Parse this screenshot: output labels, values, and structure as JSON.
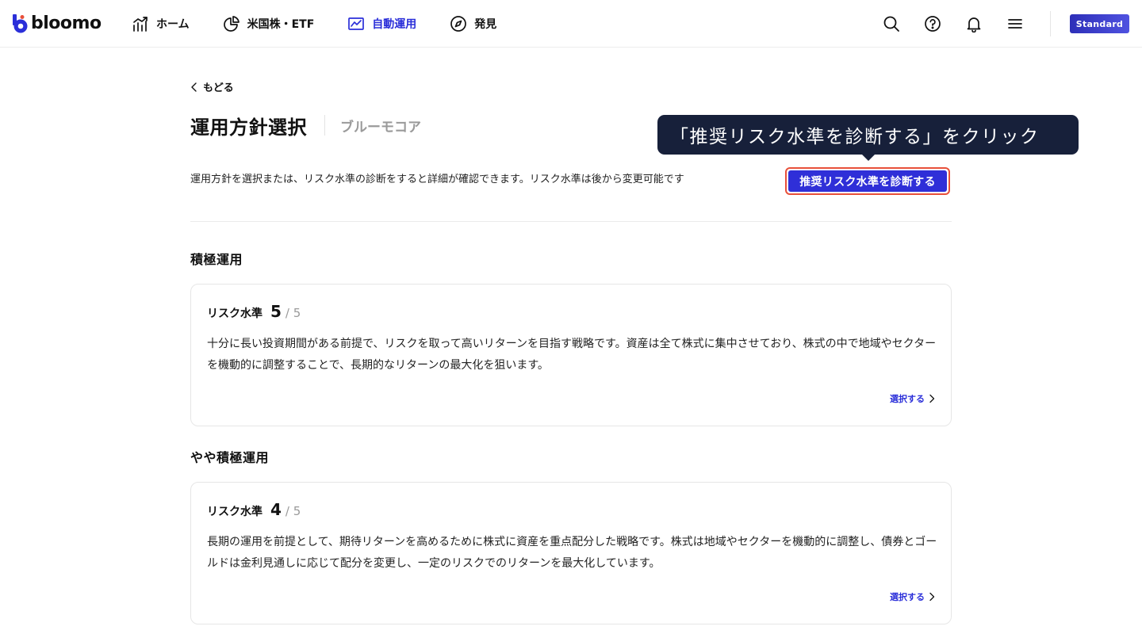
{
  "header": {
    "logo_text": "bloomo",
    "nav": [
      {
        "label": "ホーム",
        "icon": "chart-up-icon",
        "active": false
      },
      {
        "label": "米国株・ETF",
        "icon": "pie-chart-icon",
        "active": false
      },
      {
        "label": "自動運用",
        "icon": "line-chart-icon",
        "active": true
      },
      {
        "label": "発見",
        "icon": "compass-icon",
        "active": false
      }
    ],
    "icons": [
      "search-icon",
      "help-icon",
      "bell-icon",
      "menu-icon"
    ],
    "plan_badge": "Standard"
  },
  "main": {
    "back_label": "もどる",
    "title": "運用方針選択",
    "subtitle": "ブルーモコア",
    "description": "運用方針を選択または、リスク水準の診断をすると詳細が確認できます。リスク水準は後から変更可能です",
    "diagnose_button": "推奨リスク水準を診断する",
    "tooltip": "「推奨リスク水準を診断する」をクリック",
    "sections": [
      {
        "heading": "積極運用",
        "risk_label": "リスク水準",
        "risk_value": "5",
        "risk_max": "/ 5",
        "description": "十分に長い投資期間がある前提で、リスクを取って高いリターンを目指す戦略です。資産は全て株式に集中させており、株式の中で地域やセクターを機動的に調整することで、長期的なリターンの最大化を狙います。",
        "select_label": "選択する"
      },
      {
        "heading": "やや積極運用",
        "risk_label": "リスク水準",
        "risk_value": "4",
        "risk_max": "/ 5",
        "description": "長期の運用を前提として、期待リターンを高めるために株式に資産を重点配分した戦略です。株式は地域やセクターを機動的に調整し、債券とゴールドは金利見通しに応じて配分を変更し、一定のリスクでのリターンを最大化しています。",
        "select_label": "選択する"
      }
    ]
  },
  "colors": {
    "accent": "#2b2fd9",
    "button": "#2f2fd8",
    "highlight_border": "#e8503a",
    "tooltip_bg": "#17203a"
  }
}
